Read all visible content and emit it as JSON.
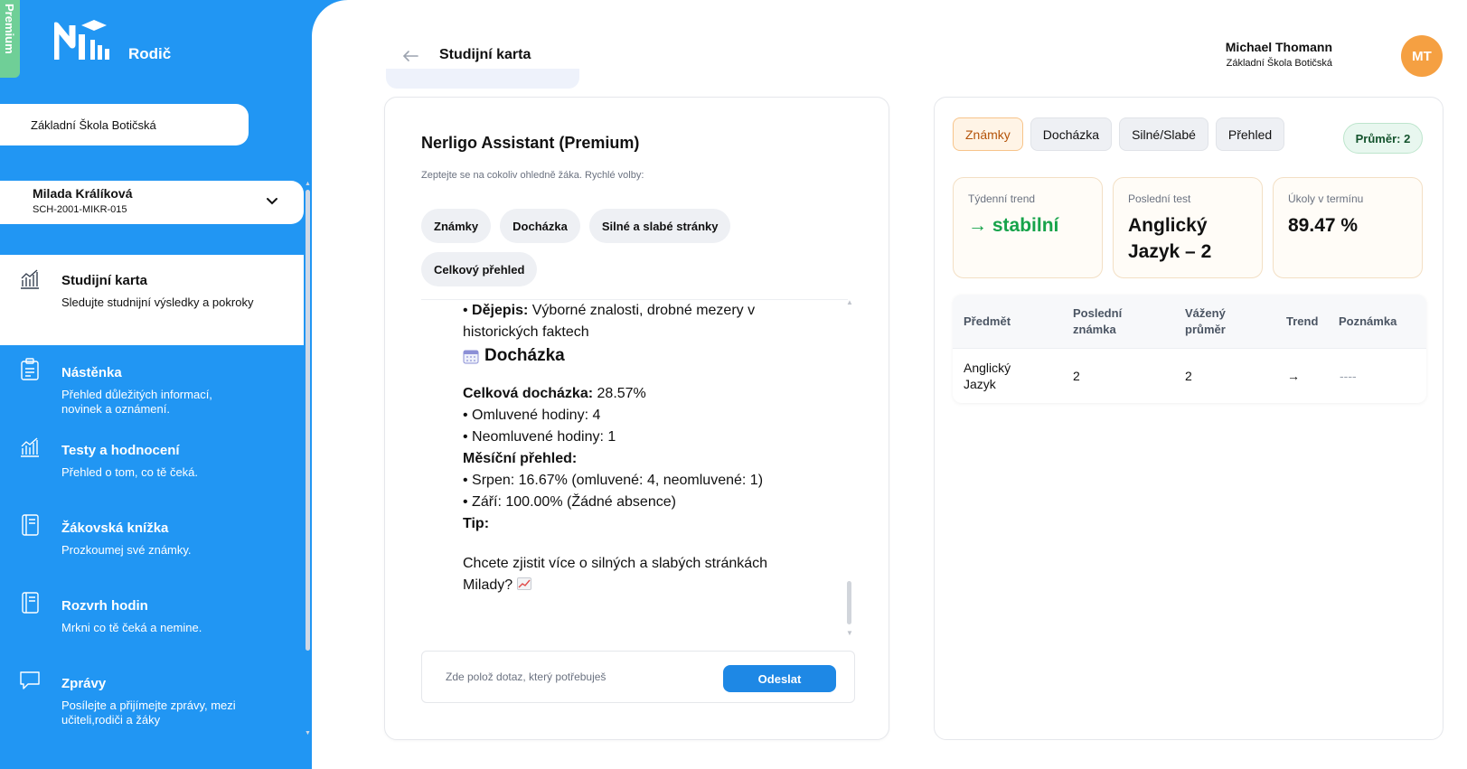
{
  "sidebar": {
    "premium_label": "Premium",
    "role": "Rodič",
    "school": "Základní Škola Botičská",
    "student": {
      "name": "Milada Králíková",
      "id": "SCH-2001-MIKR-015"
    },
    "items": [
      {
        "icon": "chart-icon",
        "title": "Studijní karta",
        "desc": "Sledujte studnijní výsledky a pokroky"
      },
      {
        "icon": "clipboard-icon",
        "title": "Nástěnka",
        "desc": "Přehled důležitých informací, novinek a oznámení."
      },
      {
        "icon": "chart-icon",
        "title": "Testy a hodnocení",
        "desc": "Přehled o tom, co tě čeká."
      },
      {
        "icon": "book-icon",
        "title": "Žákovská knížka",
        "desc": "Prozkoumej své známky."
      },
      {
        "icon": "book-icon",
        "title": "Rozvrh hodin",
        "desc": "Mrkni co tě čeká a nemine."
      },
      {
        "icon": "chat-bubble-icon",
        "title": "Zprávy",
        "desc": "Posílejte a přijímejte zprávy, mezi učiteli,rodiči a žáky"
      }
    ]
  },
  "header": {
    "title": "Studijní karta",
    "user_name": "Michael Thomann",
    "user_school": "Základní Škola Botičská",
    "avatar_initials": "MT",
    "avatar_color": "#f5a042"
  },
  "chat": {
    "title": "Nerligo Assistant (Premium)",
    "subtitle": "Zeptejte se na cokoliv ohledně žáka. Rychlé volby:",
    "quick_options": [
      "Známky",
      "Docházka",
      "Silné a slabé stránky",
      "Celkový přehled"
    ],
    "message": {
      "dejepis_label": "Dějepis:",
      "dejepis_text": "Výborné znalosti, drobné mezery v historických faktech",
      "heading": "Docházka",
      "total_label": "Celková docházka:",
      "total_value": "28.57%",
      "excused": "Omluvené hodiny: 4",
      "unexcused": "Neomluvené hodiny: 1",
      "monthly_label": "Měsíční přehled:",
      "month1": "Srpen: 16.67% (omluvené: 4, neomluvené: 1)",
      "month2": "Září: 100.00% (Žádné absence)",
      "tip_label": "Tip:",
      "question": "Chcete zjistit více o silných a slabých stránkách Milady?"
    },
    "input_placeholder": "Zde polož dotaz, který potřebuješ",
    "send_label": "Odeslat"
  },
  "panel": {
    "tabs": [
      "Známky",
      "Docházka",
      "Silné/Slabé",
      "Přehled"
    ],
    "active_tab": "Známky",
    "average_badge": "Průměr: 2",
    "stats": [
      {
        "label": "Týdenní trend",
        "value": "stabilní",
        "arrow": "→"
      },
      {
        "label": "Poslední test",
        "value": "Anglický Jazyk – 2"
      },
      {
        "label": "Úkoly v termínu",
        "value": "89.47 %"
      }
    ],
    "table": {
      "headers": [
        "Předmět",
        "Poslední známka",
        "Vážený průměr",
        "Trend",
        "Poznámka"
      ],
      "rows": [
        {
          "subject": "Anglický Jazyk",
          "last_grade": "2",
          "weighted_avg": "2",
          "trend": "→",
          "note": "----"
        }
      ]
    }
  },
  "colors": {
    "sidebar": "#2196f3",
    "accent": "#1e88e5",
    "premium": "#6fcf97",
    "trend_green": "#16a34a"
  }
}
